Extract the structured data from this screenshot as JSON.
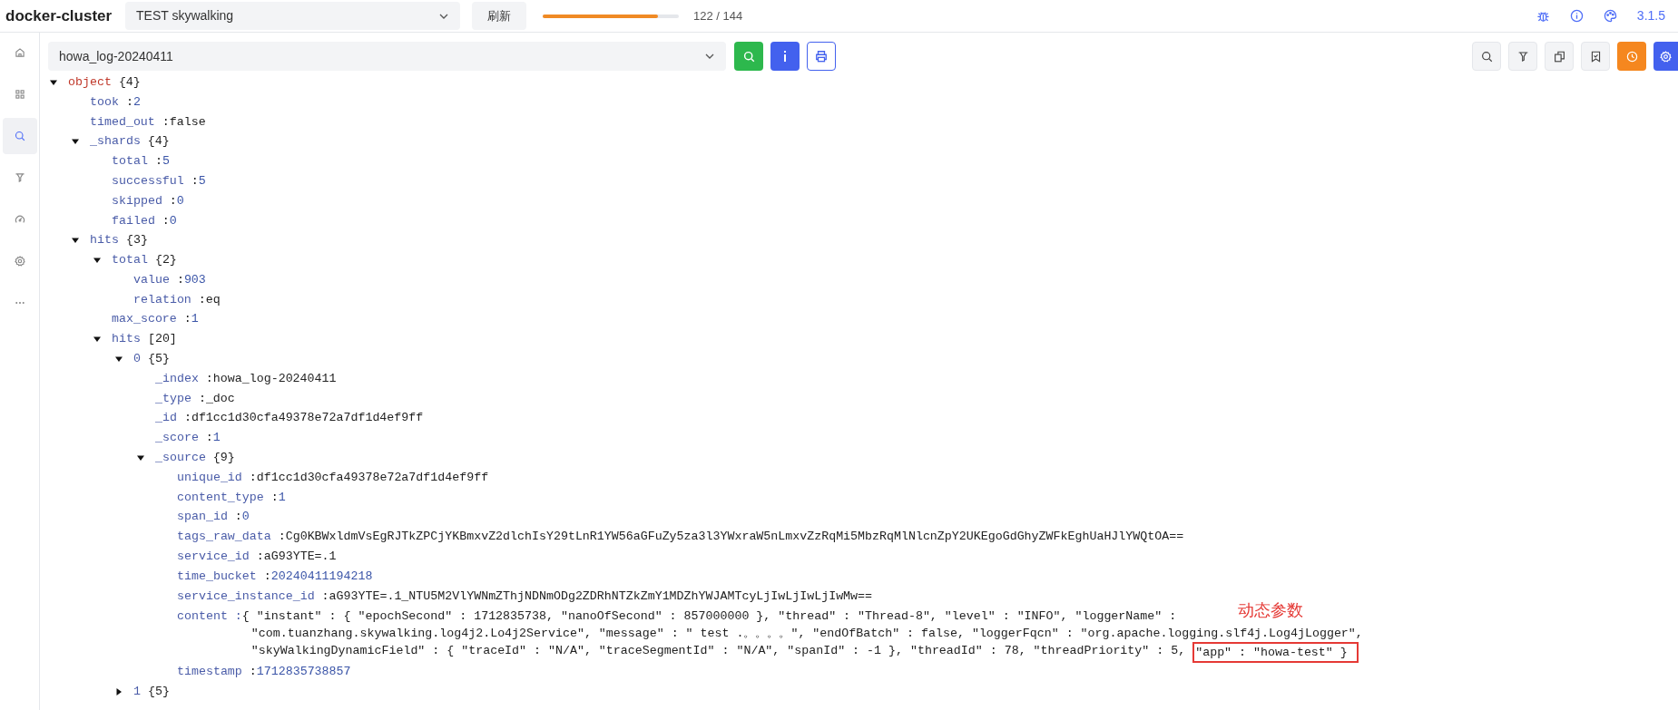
{
  "header": {
    "cluster": "docker-cluster",
    "cluster_select": "TEST skywalking",
    "refresh_button": "刷新",
    "progress": {
      "level": 0.847,
      "reading": "122 / 144"
    },
    "version": "3.1.5"
  },
  "sidebar": {
    "items": [
      {
        "selected": false
      },
      {
        "selected": false
      },
      {
        "selected": true
      },
      {
        "selected": false
      },
      {
        "selected": false
      },
      {
        "selected": false
      },
      {
        "selected": false
      }
    ]
  },
  "index_select": "howa_log-20240411",
  "tree": {
    "separator": ":",
    "root": {
      "key": "object",
      "summary": "{4}",
      "expanded": true,
      "children": [
        {
          "key": "took",
          "value": "2",
          "kind": "number"
        },
        {
          "key": "timed_out",
          "value": "false",
          "kind": "boolean"
        },
        {
          "key": "_shards",
          "summary": "{4}",
          "expanded": true,
          "children": [
            {
              "key": "total",
              "value": "5",
              "kind": "number"
            },
            {
              "key": "successful",
              "value": "5",
              "kind": "number"
            },
            {
              "key": "skipped",
              "value": "0",
              "kind": "number"
            },
            {
              "key": "failed",
              "value": "0",
              "kind": "number"
            }
          ]
        },
        {
          "key": "hits",
          "summary": "{3}",
          "expanded": true,
          "children": [
            {
              "key": "total",
              "summary": "{2}",
              "expanded": true,
              "children": [
                {
                  "key": "value",
                  "value": "903",
                  "kind": "number"
                },
                {
                  "key": "relation",
                  "value": "eq",
                  "kind": "string"
                }
              ]
            },
            {
              "key": "max_score",
              "value": "1",
              "kind": "number"
            },
            {
              "key": "hits",
              "summary": "[20]",
              "expanded": true,
              "children": [
                {
                  "key": "0",
                  "summary": "{5}",
                  "expanded": true,
                  "children": [
                    {
                      "key": "_index",
                      "value": "howa_log-20240411",
                      "kind": "string"
                    },
                    {
                      "key": "_type",
                      "value": "_doc",
                      "kind": "string"
                    },
                    {
                      "key": "_id",
                      "value": "df1cc1d30cfa49378e72a7df1d4ef9ff",
                      "kind": "string"
                    },
                    {
                      "key": "_score",
                      "value": "1",
                      "kind": "number"
                    },
                    {
                      "key": "_source",
                      "summary": "{9}",
                      "expanded": true,
                      "children": [
                        {
                          "key": "unique_id",
                          "value": "df1cc1d30cfa49378e72a7df1d4ef9ff",
                          "kind": "string"
                        },
                        {
                          "key": "content_type",
                          "value": "1",
                          "kind": "number"
                        },
                        {
                          "key": "span_id",
                          "value": "0",
                          "kind": "number"
                        },
                        {
                          "key": "tags_raw_data",
                          "value": "Cg0KBWxldmVsEgRJTkZPCjYKBmxvZ2dlchIsY29tLnR1YW56aGFuZy5za3l3YWxraW5nLmxvZzRqMi5MbzRqMlNlcnZpY2UKEgoGdGhyZWFkEghUaHJlYWQtOA==",
                          "kind": "string"
                        },
                        {
                          "key": "service_id",
                          "value": "aG93YTE=.1",
                          "kind": "string"
                        },
                        {
                          "key": "time_bucket",
                          "value": "20240411194218",
                          "kind": "number"
                        },
                        {
                          "key": "service_instance_id",
                          "value": "aG93YTE=.1_NTU5M2VlYWNmZThjNDNmODg2ZDRhNTZkZmY1MDZhYWJAMTcyLjIwLjIwLjIwMw==",
                          "kind": "string"
                        },
                        {
                          "key": "content",
                          "kind": "multiline",
                          "lines": [
                            "{ \"instant\" : { \"epochSecond\" : 1712835738, \"nanoOfSecond\" : 857000000 }, \"thread\" : \"Thread-8\", \"level\" : \"INFO\", \"loggerName\" :",
                            "\"com.tuanzhang.skywalking.log4j2.Lo4j2Service\", \"message\" : \" test .。。。。\", \"endOfBatch\" : false, \"loggerFqcn\" : \"org.apache.logging.slf4j.Log4jLogger\",",
                            "\"skyWalkingDynamicField\" : { \"traceId\" : \"N/A\", \"traceSegmentId\" : \"N/A\", \"spanId\" : -1 }, \"threadId\" : 78, \"threadPriority\" : 5,"
                          ],
                          "highlight": "\"app\" : \"howa-test\" }",
                          "annotation": "动态参数"
                        },
                        {
                          "key": "timestamp",
                          "value": "1712835738857",
                          "kind": "number"
                        }
                      ]
                    }
                  ]
                },
                {
                  "key": "1",
                  "summary": "{5}",
                  "expanded": false
                }
              ]
            }
          ]
        }
      ]
    }
  }
}
